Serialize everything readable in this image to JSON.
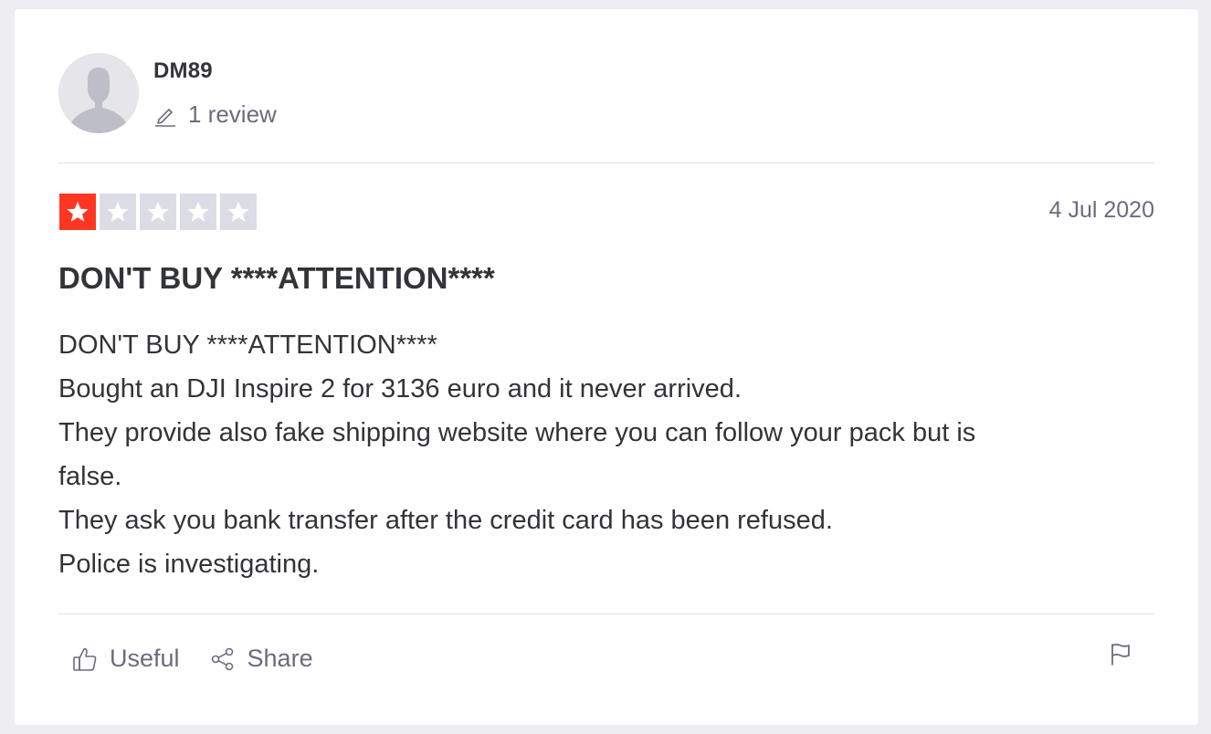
{
  "reviewer": {
    "name": "DM89",
    "review_count_label": "1 review",
    "avatar_icon": "user-silhouette-icon"
  },
  "rating": {
    "stars": 1,
    "max": 5,
    "filled_color": "#ff3722",
    "empty_color": "#dcdce6"
  },
  "review": {
    "date": "4 Jul 2020",
    "title": "DON'T BUY ****ATTENTION****",
    "lines": [
      "DON'T BUY ****ATTENTION****",
      "Bought an DJI Inspire 2 for 3136 euro and it never arrived.",
      "They provide also fake shipping website where you can follow your pack but is",
      "false.",
      "They ask you bank transfer after the credit card has been refused.",
      "Police is investigating."
    ]
  },
  "actions": {
    "useful_label": "Useful",
    "useful_icon": "thumbs-up-icon",
    "share_label": "Share",
    "share_icon": "share-icon",
    "report_icon": "flag-icon"
  }
}
